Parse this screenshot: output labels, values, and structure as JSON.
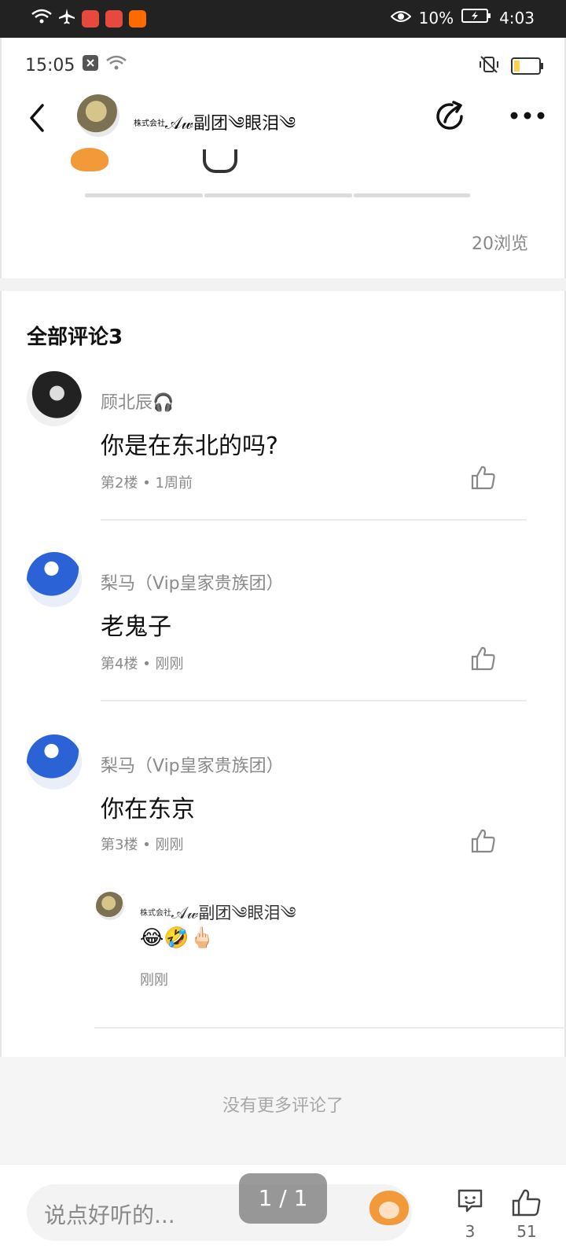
{
  "device_status": {
    "time": "4:03",
    "battery_percent": "10%"
  },
  "app_status": {
    "time": "15:05"
  },
  "header": {
    "group_prefix": "株式会社",
    "name": "𝒜𝓌副团༄眼泪༄"
  },
  "post": {
    "views": "20浏览"
  },
  "comments_section": {
    "title": "全部评论3",
    "items": [
      {
        "name": "顾北辰🎧",
        "text": "你是在东北的吗?",
        "floor": "第2楼",
        "dot": "•",
        "time": "1周前"
      },
      {
        "name": "梨马（Vip皇家贵族团）",
        "text": "老鬼子",
        "floor": "第4楼",
        "dot": "•",
        "time": "刚刚"
      },
      {
        "name": "梨马（Vip皇家贵族团）",
        "text": "你在东京",
        "floor": "第3楼",
        "dot": "•",
        "time": "刚刚"
      }
    ],
    "reply": {
      "prefix": "株式会社",
      "name": "𝒜𝓌副团༄眼泪༄",
      "emoji": "😂🤣🖕🏻",
      "time": "刚刚"
    },
    "no_more": "没有更多评论了"
  },
  "bottom_bar": {
    "input_placeholder": "说点好听的...",
    "pager": "1 / 1",
    "comment_count": "3",
    "like_count": "51"
  },
  "colors": {
    "accent_orange": "#f29a3a",
    "muted_text": "#8a8a8a",
    "separator": "#f2f2f2"
  }
}
